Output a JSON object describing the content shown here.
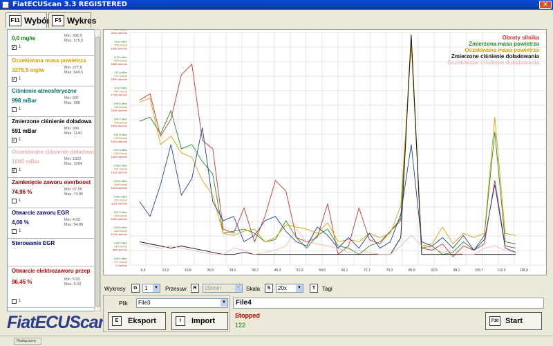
{
  "window": {
    "title": "FiatECUScan 3.3 REGISTERED"
  },
  "tabs": [
    {
      "key": "F11",
      "label": "Wybór"
    },
    {
      "key": "F5",
      "label": "Wykres"
    }
  ],
  "sensors": [
    {
      "name": "",
      "value": "0,0 mg/w",
      "min": "Min. 286,5",
      "max": "Max. 575,0",
      "checked": true,
      "check_label": "1",
      "color": "#008000"
    },
    {
      "name": "Oczekiwana masa powietrza",
      "value": "3275,5 mg/w",
      "min": "Min. 277,8",
      "max": "Max. 649,5",
      "checked": true,
      "check_label": "1",
      "color": "#e0a000"
    },
    {
      "name": "Ciśnienie atmosferyczne",
      "value": "998 mBar",
      "min": "Min. 997",
      "max": "Max. 998",
      "checked": false,
      "check_label": "1",
      "color": "#007070"
    },
    {
      "name": "Zmierzone ciśnienie doładowa",
      "value": "591 mBar",
      "min": "Min. 999",
      "max": "Max. 1140",
      "checked": true,
      "check_label": "1",
      "color": "#000000"
    },
    {
      "name": "Oczekiwane ciśnienie doładowa",
      "value": "1000 mBar",
      "min": "Min. 1022",
      "max": "Max. 1084",
      "checked": true,
      "check_label": "1",
      "color": "#f0b0b0"
    },
    {
      "name": "Zamknięcie zaworu overboost",
      "value": "74,96 %",
      "min": "Min. 67,55",
      "max": "Max. 74,96",
      "checked": false,
      "check_label": "1",
      "color": "#a00000"
    },
    {
      "name": "Otwarcie zaworu EGR",
      "value": "4,00 %",
      "min": "Min. 4,00",
      "max": "Max. 54,80",
      "checked": false,
      "check_label": "1",
      "color": "#000080"
    },
    {
      "name": "Sterowanie EGR",
      "value": "",
      "min": "",
      "max": "",
      "checked": false,
      "check_label": "",
      "color": "#000080"
    },
    {
      "name": "Otwarcie elektrozaworu przep",
      "value": "96,45 %",
      "min": "Min. 5,00",
      "max": "Max. 5,00",
      "checked": false,
      "check_label": "1",
      "color": "#c00000"
    }
  ],
  "logo": "FiatECUScan",
  "controls": {
    "wykresy_label": "Wykresy",
    "wykresy_key": "G",
    "wykresy_value": "1",
    "przesuw_label": "Przesuw",
    "przesuw_key": "R",
    "przesuw_value": "20/min",
    "skala_label": "Skala",
    "skala_key": "S",
    "skala_value": "20x",
    "tagi_key": "T",
    "tagi_label": "Tagi"
  },
  "file": {
    "label": "Plik",
    "value": "File3",
    "export_key": "E",
    "export_label": "Eksport",
    "import_key": "I",
    "import_label": "Import"
  },
  "status": {
    "filename": "File4",
    "state": "Stopped",
    "count": "122",
    "start_key": "F10",
    "start_label": "Start",
    "connection": "Rozłączony"
  },
  "chart_data": {
    "type": "line",
    "x_ticks": [
      "6,6",
      "13,2",
      "19,8",
      "26,5",
      "33,1",
      "39,7",
      "46,3",
      "52,9",
      "59,5",
      "66,1",
      "72,7",
      "79,3",
      "85,9",
      "92,5",
      "99,1",
      "105,7",
      "112,3",
      "118,9"
    ],
    "y_left_labels": [
      [
        "541 k/s/cyl",
        "2040 obr/min"
      ],
      [
        "1110 mBar",
        "955 k/s/cyl",
        "1960 obr/min"
      ],
      [
        "1130 mBar",
        "590 k/s/cyl",
        "1885 obr/min"
      ],
      [
        "1111 mBar",
        "571 k/s/cyl",
        "1800 obr/min"
      ],
      [
        "1102 mBar",
        "541 k/s/cyl",
        "1735 obr/min"
      ],
      [
        "1081 mBar",
        "523 k/s/cyl",
        "1654 obr/min"
      ],
      [
        "1067 mBar",
        "495 k/s/cyl",
        "1583 obr/min"
      ],
      [
        "1051 mBar",
        "475 k/s/cyl",
        "1493 obr/min"
      ],
      [
        "1041 mBar",
        "445 k/s/cyl",
        "1400 obr/min"
      ],
      [
        "1030 mBar",
        "421 k/s/cyl",
        "1310 obr/min"
      ],
      [
        "1016 mBar",
        "398 k/s/cyl",
        "1226 obr/min"
      ],
      [
        "1005 mBar",
        "371 k/s/cyl",
        "1151 obr/min"
      ],
      [
        "1007 mBar",
        "346 k/s/cyl",
        "1082 obr/min"
      ],
      [
        "1000 mBar",
        "326 k/s/cyl",
        "1016 obr/min"
      ],
      [
        "1000 mBar",
        "314 k/s/cyl",
        "954 obr/min"
      ],
      [
        "1000 mBar",
        "277 k/s/cyl",
        "0 obr/min"
      ]
    ],
    "series": [
      {
        "name": "Obroty silnika",
        "color": "#d03030",
        "values": [
          1730,
          1760,
          1560,
          1640,
          1850,
          1900,
          1540,
          1500,
          1120,
          1100,
          1220,
          1060,
          1180,
          1350,
          1300,
          1080,
          1060,
          1080,
          1240,
          1000,
          1040,
          1220,
          1070,
          1050,
          1110,
          1160,
          2040,
          1030,
          1020,
          1050,
          990,
          1040,
          1020,
          1050,
          1350,
          1040,
          1030
        ]
      },
      {
        "name": "Zmierzona masa powietrza",
        "color": "#209020",
        "values": [
          1630,
          1650,
          1570,
          1680,
          1500,
          1520,
          1440,
          1380,
          1100,
          1110,
          1120,
          1100,
          1060,
          1070,
          1160,
          1080,
          1030,
          1090,
          1120,
          1040,
          1030,
          1000,
          1040,
          1060,
          1110,
          1170,
          2030,
          1030,
          1040,
          1000,
          1010,
          1060,
          1020,
          1090,
          1580,
          1060,
          1050
        ]
      },
      {
        "name": "Oczekiwana masa powietrza",
        "color": "#e0a000",
        "values": [
          1720,
          1740,
          1520,
          1560,
          1480,
          1460,
          1350,
          1280,
          1100,
          1090,
          1110,
          1120,
          1060,
          1080,
          1140,
          1130,
          1120,
          1100,
          1150,
          1060,
          1070,
          1060,
          1100,
          1080,
          1100,
          1230,
          1990,
          1040,
          1050,
          1130,
          1050,
          1100,
          1080,
          1100,
          1650,
          1100,
          1090
        ]
      },
      {
        "name": "Zmierzone ciśnienie doładowania",
        "color": "#101010",
        "values": [
          1060,
          1050,
          1040,
          1030,
          1040,
          1030,
          1020,
          1010,
          1000,
          1000,
          1010,
          1000,
          1000,
          1000,
          1000,
          1000,
          1000,
          1000,
          1000,
          1000,
          1000,
          1000,
          1000,
          1000,
          1000,
          1080,
          2040,
          1000,
          1000,
          1000,
          1000,
          1000,
          1000,
          1000,
          1000,
          1000,
          1000
        ]
      },
      {
        "name": "Oczekiwane ciśnienie doładowania",
        "color": "#f0b8b8",
        "values": [
          1050,
          1040,
          1030,
          1040,
          1030,
          1020,
          1010,
          1000,
          1000,
          1030,
          1020,
          1000,
          1010,
          1020,
          1040,
          1120,
          1060,
          1050,
          1040,
          1030,
          1010,
          1020,
          1010,
          1000,
          1000,
          1040,
          1090,
          1040,
          1030,
          1010,
          1020,
          1000,
          1000,
          1030,
          1040,
          1020,
          1010
        ]
      },
      {
        "name": "",
        "color": "#2040a0",
        "values": [
          1250,
          1180,
          1330,
          1520,
          1280,
          1360,
          1600,
          1250,
          1160,
          1180,
          1060,
          1090,
          1160,
          1180,
          1110,
          1060,
          1040,
          1130,
          1090,
          1030,
          1080,
          1030,
          1100,
          1030,
          1060,
          1190,
          1520,
          1060,
          1040,
          1080,
          1030,
          1090,
          1020,
          1070,
          1330,
          1030,
          1010
        ]
      }
    ],
    "ylim": [
      950,
      2050
    ]
  }
}
